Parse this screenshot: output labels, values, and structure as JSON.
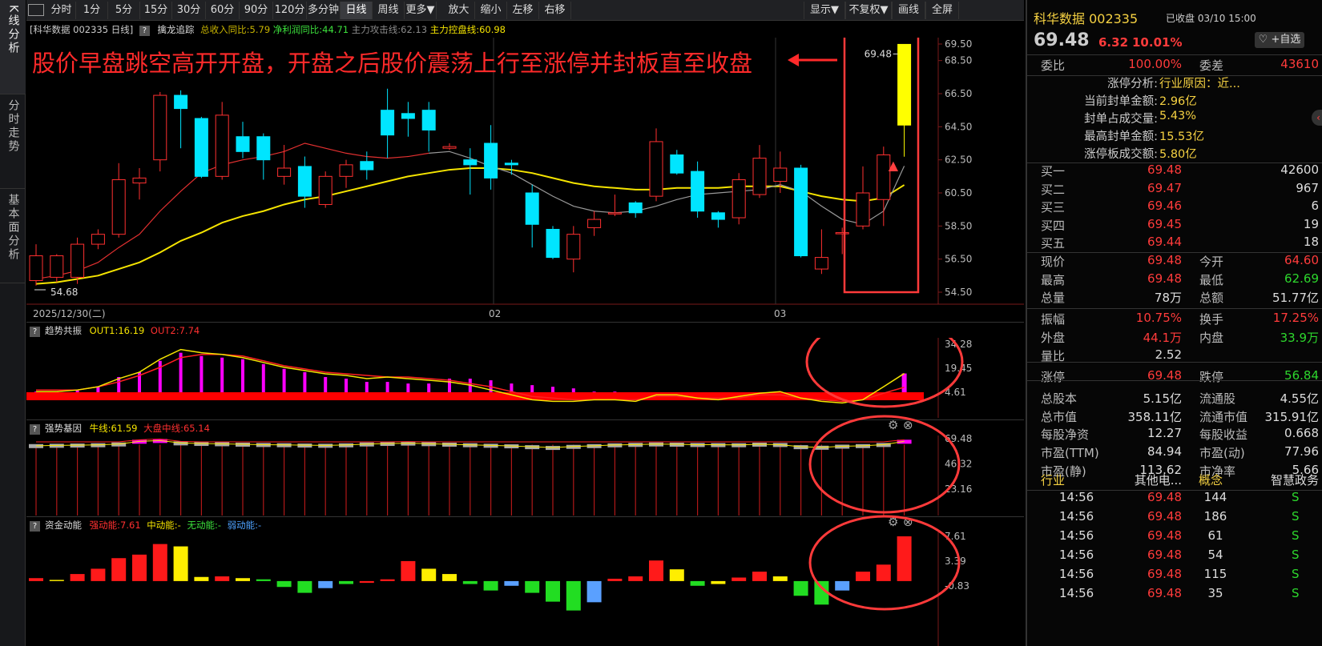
{
  "sidebar": {
    "tabs": [
      {
        "label": "K线分析",
        "active": true
      },
      {
        "label": "分时走势",
        "active": false
      },
      {
        "label": "基本面分析",
        "active": false
      }
    ]
  },
  "toolbar": {
    "periods": [
      "分时",
      "1分",
      "5分",
      "15分",
      "30分",
      "60分",
      "90分",
      "120分",
      "多分钟",
      "日线",
      "周线",
      "更多▼"
    ],
    "active_period": "日线",
    "actions": [
      "放大",
      "缩小",
      "左移",
      "右移"
    ],
    "right": [
      "显示▼",
      "不复权▼",
      "画线",
      "全屏"
    ]
  },
  "info_bar": {
    "name": "[科华数据 002335 日线]",
    "indicator": "擒龙追踪",
    "rev": "总收入同比:5.79",
    "profit": "净利润同比:44.71",
    "attack": "主力攻击线:62.13",
    "control": "主力控盘线:60.98"
  },
  "annotation": "股价早盘跳空高开开盘，开盘之后股价震荡上行至涨停并封板直至收盘",
  "main_chart": {
    "y_labels": [
      "69.50",
      "68.50",
      "66.50",
      "64.50",
      "62.50",
      "60.50",
      "58.50",
      "56.50",
      "54.50"
    ],
    "x_labels": [
      "2025/12/30(二)",
      "02",
      "03"
    ],
    "high_label": "69.48",
    "low_label": "54.68"
  },
  "chart_data": {
    "type": "candlestick",
    "ylim": [
      54.5,
      69.5
    ],
    "candles": [
      {
        "o": 55.2,
        "c": 56.7,
        "h": 57.4,
        "l": 54.9
      },
      {
        "o": 55.4,
        "c": 56.7,
        "h": 56.8,
        "l": 55.1
      },
      {
        "o": 55.4,
        "c": 57.4,
        "h": 57.8,
        "l": 55.0
      },
      {
        "o": 57.4,
        "c": 58.0,
        "h": 58.3,
        "l": 57.1
      },
      {
        "o": 58.0,
        "c": 61.3,
        "h": 62.3,
        "l": 57.8
      },
      {
        "o": 61.1,
        "c": 61.4,
        "h": 62.0,
        "l": 60.1
      },
      {
        "o": 62.5,
        "c": 66.4,
        "h": 66.6,
        "l": 61.8
      },
      {
        "o": 66.4,
        "c": 65.6,
        "h": 66.7,
        "l": 63.2
      },
      {
        "o": 65.0,
        "c": 61.5,
        "h": 65.1,
        "l": 61.4
      },
      {
        "o": 61.5,
        "c": 65.2,
        "h": 66.0,
        "l": 61.3
      },
      {
        "o": 63.9,
        "c": 63.0,
        "h": 64.8,
        "l": 62.6
      },
      {
        "o": 63.9,
        "c": 62.5,
        "h": 64.1,
        "l": 61.3
      },
      {
        "o": 61.5,
        "c": 62.0,
        "h": 63.4,
        "l": 61.0
      },
      {
        "o": 62.1,
        "c": 60.3,
        "h": 62.7,
        "l": 59.6
      },
      {
        "o": 59.8,
        "c": 61.5,
        "h": 61.8,
        "l": 59.6
      },
      {
        "o": 61.5,
        "c": 62.2,
        "h": 62.5,
        "l": 60.8
      },
      {
        "o": 62.4,
        "c": 61.9,
        "h": 63.0,
        "l": 61.3
      },
      {
        "o": 65.5,
        "c": 64.0,
        "h": 66.8,
        "l": 62.6
      },
      {
        "o": 65.3,
        "c": 65.0,
        "h": 66.0,
        "l": 63.9
      },
      {
        "o": 65.5,
        "c": 64.3,
        "h": 66.0,
        "l": 63.0
      },
      {
        "o": 63.2,
        "c": 63.3,
        "h": 63.5,
        "l": 63.1
      },
      {
        "o": 62.5,
        "c": 62.2,
        "h": 63.2,
        "l": 60.4
      },
      {
        "o": 63.5,
        "c": 61.4,
        "h": 64.6,
        "l": 60.7
      },
      {
        "o": 62.3,
        "c": 62.2,
        "h": 62.5,
        "l": 61.6
      },
      {
        "o": 60.5,
        "c": 58.6,
        "h": 61.0,
        "l": 57.2
      },
      {
        "o": 58.3,
        "c": 56.6,
        "h": 58.5,
        "l": 56.5
      },
      {
        "o": 56.5,
        "c": 58.0,
        "h": 58.5,
        "l": 55.7
      },
      {
        "o": 58.4,
        "c": 58.9,
        "h": 59.4,
        "l": 57.9
      },
      {
        "o": 59.3,
        "c": 59.3,
        "h": 60.4,
        "l": 59.1
      },
      {
        "o": 59.9,
        "c": 59.3,
        "h": 60.0,
        "l": 59.0
      },
      {
        "o": 60.3,
        "c": 63.6,
        "h": 64.4,
        "l": 60.0
      },
      {
        "o": 62.8,
        "c": 61.7,
        "h": 63.1,
        "l": 61.6
      },
      {
        "o": 61.8,
        "c": 59.4,
        "h": 62.4,
        "l": 59.0
      },
      {
        "o": 59.3,
        "c": 58.9,
        "h": 59.4,
        "l": 58.4
      },
      {
        "o": 59.0,
        "c": 61.3,
        "h": 61.7,
        "l": 58.6
      },
      {
        "o": 60.4,
        "c": 62.6,
        "h": 63.4,
        "l": 60.2
      },
      {
        "o": 61.2,
        "c": 62.0,
        "h": 63.0,
        "l": 60.5
      },
      {
        "o": 62.0,
        "c": 56.7,
        "h": 62.2,
        "l": 56.6
      },
      {
        "o": 55.9,
        "c": 56.6,
        "h": 58.3,
        "l": 55.6
      },
      {
        "o": 58.1,
        "c": 58.1,
        "h": 58.4,
        "l": 56.8
      },
      {
        "o": 58.5,
        "c": 60.5,
        "h": 62.1,
        "l": 58.3
      },
      {
        "o": 60.1,
        "c": 62.8,
        "h": 63.3,
        "l": 58.5
      },
      {
        "o": 64.6,
        "c": 69.48,
        "h": 69.48,
        "l": 62.69
      }
    ],
    "ma_fast": [
      55.3,
      55.5,
      55.8,
      56.3,
      57.2,
      58.0,
      59.4,
      60.6,
      61.7,
      62.2,
      62.5,
      62.7,
      63.0,
      63.5,
      63.2,
      62.9,
      62.7,
      62.6,
      62.7,
      62.9,
      63.0,
      62.6,
      62.1,
      61.7,
      61.0,
      60.3,
      59.7,
      59.4,
      59.3,
      59.4,
      59.7,
      60.1,
      60.4,
      60.5,
      60.6,
      60.7,
      61.0,
      60.6,
      59.7,
      58.9,
      58.6,
      59.4,
      62.13
    ],
    "ma_slow": [
      55.0,
      55.1,
      55.3,
      55.5,
      55.9,
      56.3,
      56.9,
      57.6,
      58.1,
      58.7,
      59.1,
      59.4,
      59.8,
      60.1,
      60.3,
      60.6,
      60.9,
      61.2,
      61.5,
      61.7,
      61.9,
      62.0,
      62.0,
      61.9,
      61.7,
      61.4,
      61.1,
      60.9,
      60.8,
      60.7,
      60.7,
      60.8,
      60.8,
      60.8,
      60.9,
      60.9,
      60.9,
      60.6,
      60.3,
      60.1,
      60.0,
      60.2,
      60.98
    ]
  },
  "sub1": {
    "title": "趋势共振",
    "out1": "OUT1:16.19",
    "out2": "OUT2:7.74",
    "y_labels": [
      "34.28",
      "19.45",
      "4.61"
    ]
  },
  "sub2": {
    "title": "强势基因",
    "niu": "牛线:61.59",
    "dapan": "大盘中线:65.14",
    "y_labels": [
      "69.48",
      "46.32",
      "23.16"
    ]
  },
  "sub3": {
    "title": "资金动能",
    "strong": "强动能:7.61",
    "mid": "中动能:-",
    "none": "无动能:-",
    "weak": "弱动能:-",
    "y_labels": [
      "7.61",
      "3.39",
      "-0.83"
    ]
  },
  "right_panel": {
    "title": "科华数据 002335",
    "closed": "已收盘 03/10 15:00",
    "price": "69.48",
    "change": "6.32",
    "pct": "10.01%",
    "watch_btn": "+自选",
    "weibi_label": "委比",
    "weibi": "100.00%",
    "weicha_label": "委差",
    "weicha": "43610",
    "limit_info": [
      {
        "label": "涨停分析:",
        "value": "行业原因：近..."
      },
      {
        "label": "当前封单金额:",
        "value": "2.96亿"
      },
      {
        "label": "封单占成交量:",
        "value": "5.43%"
      },
      {
        "label": "最高封单金额:",
        "value": "15.53亿"
      },
      {
        "label": "涨停板成交额:",
        "value": "5.80亿"
      }
    ],
    "bids": [
      {
        "label": "买一",
        "price": "69.48",
        "vol": "42600"
      },
      {
        "label": "买二",
        "price": "69.47",
        "vol": "967"
      },
      {
        "label": "买三",
        "price": "69.46",
        "vol": "6"
      },
      {
        "label": "买四",
        "price": "69.45",
        "vol": "19"
      },
      {
        "label": "买五",
        "price": "69.44",
        "vol": "18"
      }
    ],
    "stats": [
      {
        "l1": "现价",
        "v1": "69.48",
        "c1": "red",
        "l2": "今开",
        "v2": "64.60",
        "c2": "red"
      },
      {
        "l1": "最高",
        "v1": "69.48",
        "c1": "red",
        "l2": "最低",
        "v2": "62.69",
        "c2": "green"
      },
      {
        "l1": "总量",
        "v1": "78万",
        "c1": "white",
        "l2": "总额",
        "v2": "51.77亿",
        "c2": "white"
      },
      {
        "l1": "振幅",
        "v1": "10.75%",
        "c1": "red",
        "l2": "换手",
        "v2": "17.25%",
        "c2": "red"
      },
      {
        "l1": "外盘",
        "v1": "44.1万",
        "c1": "red",
        "l2": "内盘",
        "v2": "33.9万",
        "c2": "green"
      },
      {
        "l1": "量比",
        "v1": "2.52",
        "c1": "white",
        "l2": "",
        "v2": "",
        "c2": "white"
      },
      {
        "l1": "涨停",
        "v1": "69.48",
        "c1": "red",
        "l2": "跌停",
        "v2": "56.84",
        "c2": "green"
      },
      {
        "l1": "总股本",
        "v1": "5.15亿",
        "c1": "white",
        "l2": "流通股",
        "v2": "4.55亿",
        "c2": "white"
      },
      {
        "l1": "总市值",
        "v1": "358.11亿",
        "c1": "white",
        "l2": "流通市值",
        "v2": "315.91亿",
        "c2": "white"
      },
      {
        "l1": "每股净资",
        "v1": "12.27",
        "c1": "white",
        "l2": "每股收益",
        "v2": "0.668",
        "c2": "white"
      },
      {
        "l1": "市盈(TTM)",
        "v1": "84.94",
        "c1": "white",
        "l2": "市盈(动)",
        "v2": "77.96",
        "c2": "white"
      },
      {
        "l1": "市盈(静)",
        "v1": "113.62",
        "c1": "white",
        "l2": "市净率",
        "v2": "5.66",
        "c2": "white"
      }
    ],
    "industry_label": "行业",
    "industry": "其他电...",
    "concept_label": "概念",
    "concept": "智慧政务",
    "ticks": [
      {
        "t": "14:56",
        "p": "69.48",
        "v": "144",
        "s": "S"
      },
      {
        "t": "14:56",
        "p": "69.48",
        "v": "186",
        "s": "S"
      },
      {
        "t": "14:56",
        "p": "69.48",
        "v": "61",
        "s": "S"
      },
      {
        "t": "14:56",
        "p": "69.48",
        "v": "54",
        "s": "S"
      },
      {
        "t": "14:56",
        "p": "69.48",
        "v": "115",
        "s": "S"
      },
      {
        "t": "14:56",
        "p": "69.48",
        "v": "35",
        "s": "S"
      }
    ]
  }
}
